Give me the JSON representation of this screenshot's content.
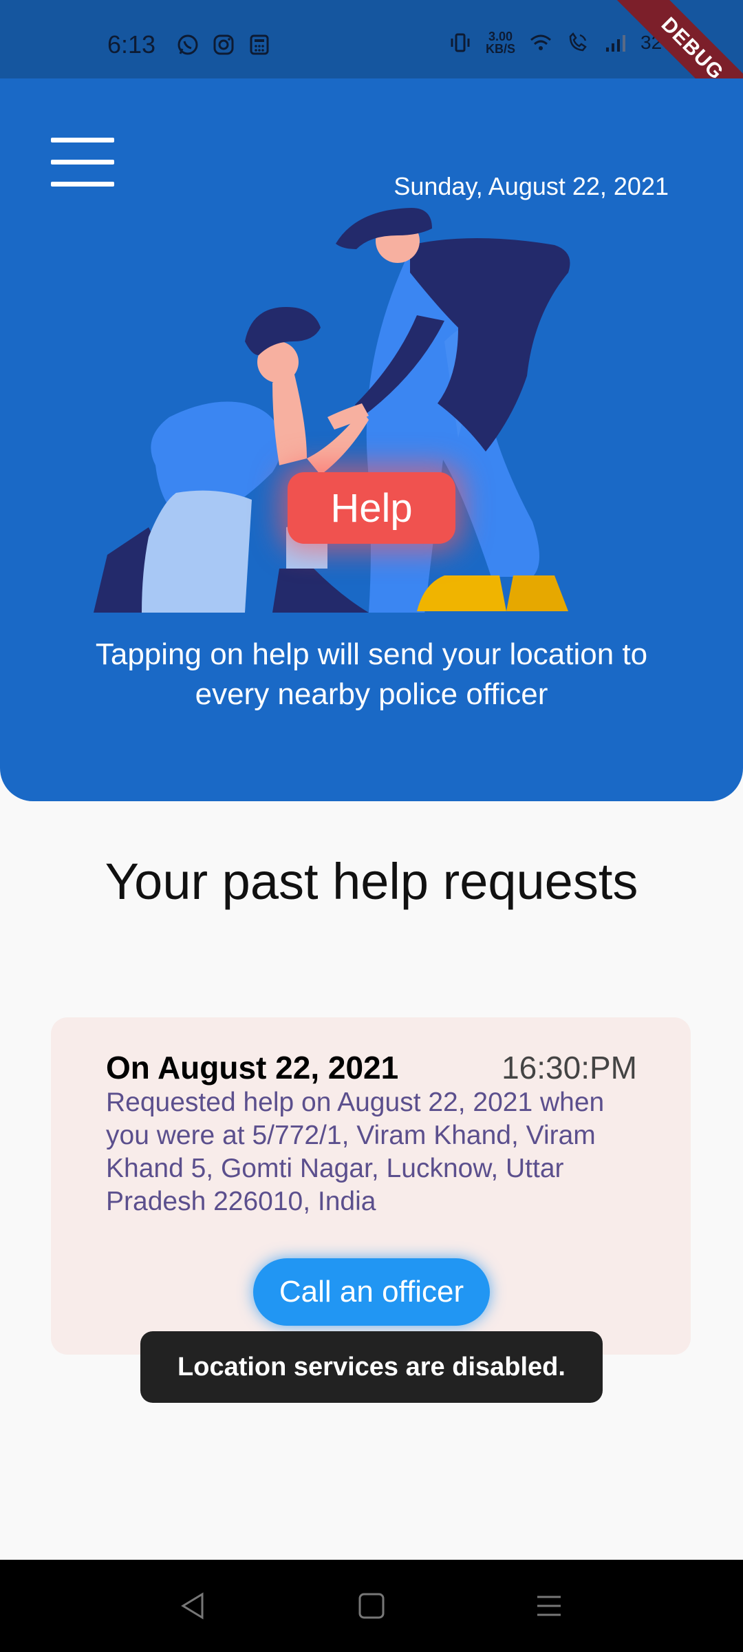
{
  "status_bar": {
    "time": "6:13",
    "speed_value": "3.00",
    "speed_unit": "KB/S",
    "battery": "32%",
    "left_icons": [
      "whatsapp-icon",
      "instagram-icon",
      "calculator-icon"
    ],
    "right_icons": [
      "vibrate-icon",
      "wifi-icon",
      "wifi-calling-icon",
      "signal-icon"
    ]
  },
  "debug_banner": "DEBUG",
  "hero": {
    "date": "Sunday, August 22, 2021",
    "help_label": "Help",
    "caption": "Tapping on help will send your location to every nearby police officer"
  },
  "past_requests": {
    "title": "Your past help requests",
    "items": [
      {
        "date": "On August 22, 2021",
        "time": "16:30:PM",
        "description": "Requested help on August 22, 2021 when you were at 5/772/1, Viram Khand, Viram Khand 5, Gomti Nagar, Lucknow, Uttar Pradesh 226010, India",
        "action_label": "Call an officer"
      }
    ]
  },
  "toast": "Location services are disabled.",
  "colors": {
    "hero_bg": "#1a69c6",
    "help_button": "#f0524f",
    "call_button": "#2196f3",
    "card_bg": "#f8ecea"
  }
}
